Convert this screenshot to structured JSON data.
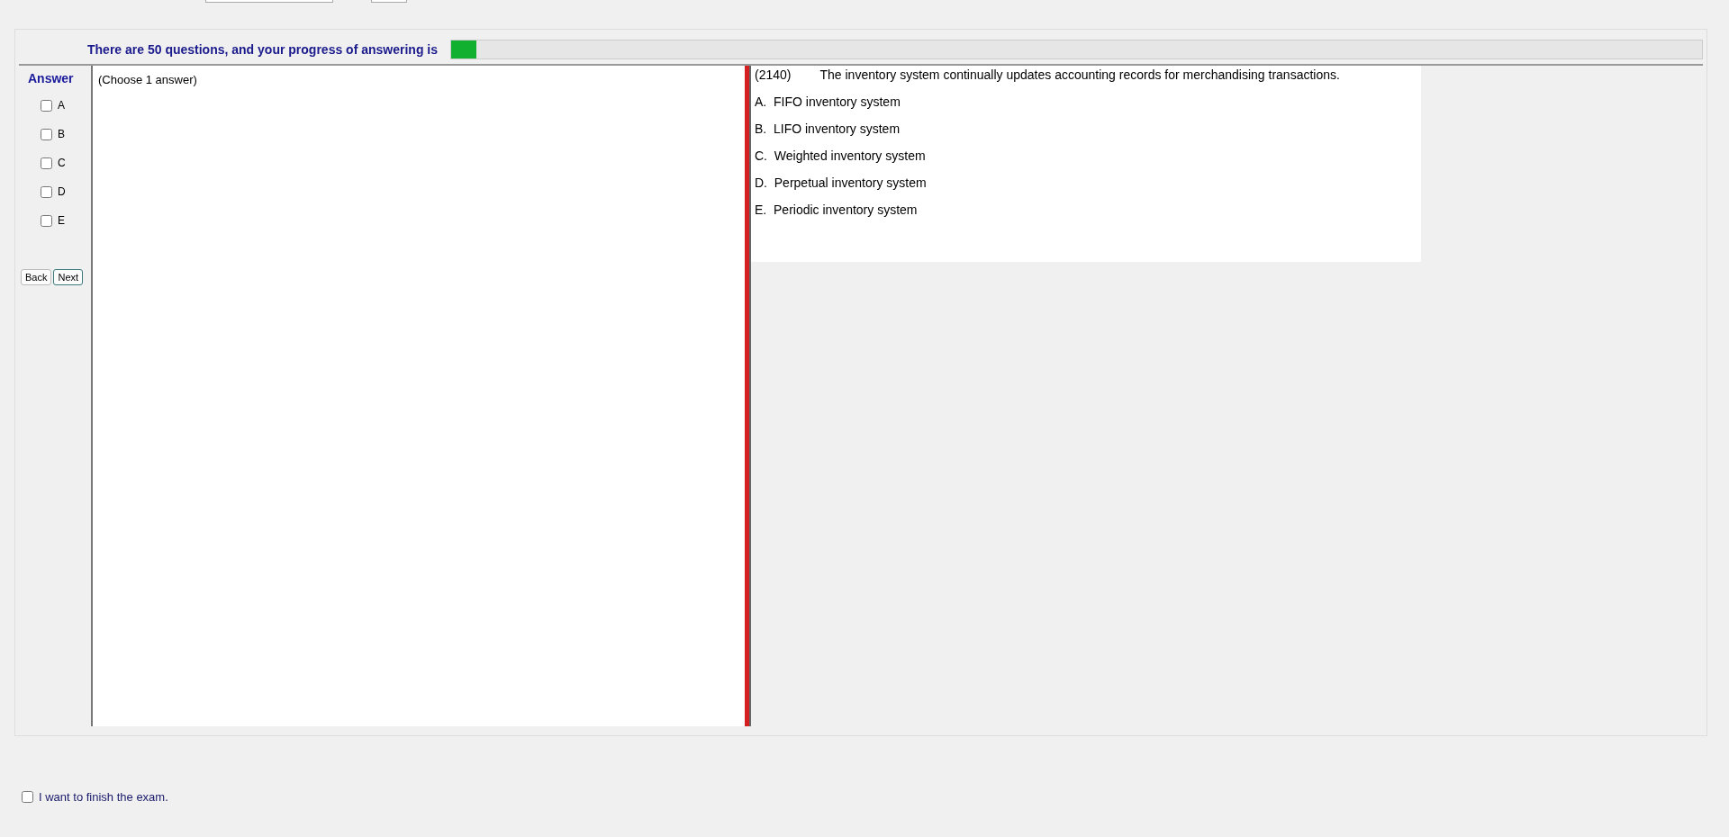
{
  "progress": {
    "label": "There are 50 questions, and your progress of answering is",
    "level": 0.02
  },
  "answer_panel": {
    "heading": "Answer",
    "options": [
      {
        "label": "A",
        "checked": false
      },
      {
        "label": "B",
        "checked": false
      },
      {
        "label": "C",
        "checked": false
      },
      {
        "label": "D",
        "checked": false
      },
      {
        "label": "E",
        "checked": false
      }
    ],
    "buttons": [
      {
        "label": "Back",
        "selected": false
      },
      {
        "label": "Next",
        "selected": true
      }
    ]
  },
  "answer_area": {
    "hint": "(Choose 1 answer)"
  },
  "question": {
    "number": "(2140)",
    "text": "The inventory system continually updates accounting records for merchandising transactions.",
    "choices": [
      "A.  FIFO inventory system",
      "B.  LIFO inventory system",
      "C.  Weighted inventory system",
      "D.  Perpetual inventory system",
      "E.  Periodic inventory system"
    ]
  },
  "finish": {
    "label": "I want to finish the exam.",
    "checked": false
  }
}
